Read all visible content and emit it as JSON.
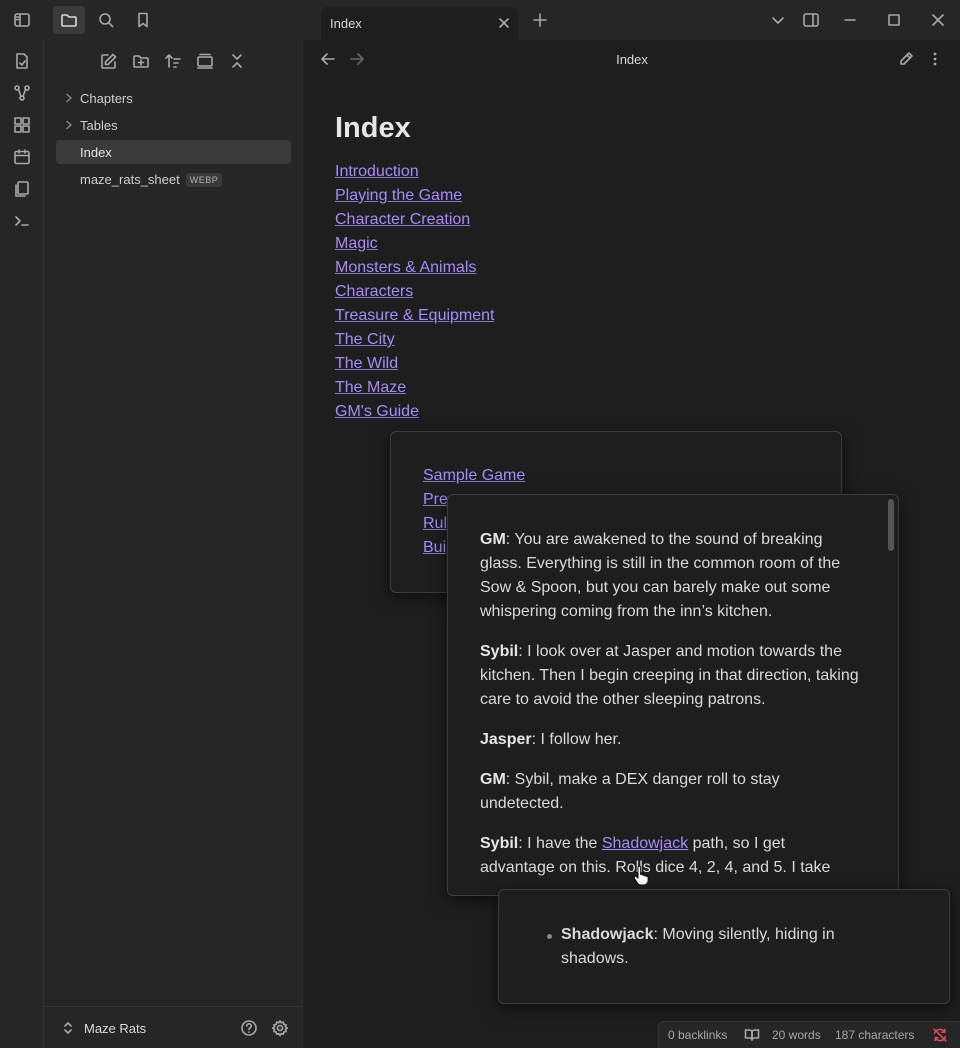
{
  "tab": {
    "title": "Index"
  },
  "view": {
    "title": "Index"
  },
  "sidebar": {
    "items": [
      {
        "label": "Chapters",
        "type": "folder"
      },
      {
        "label": "Tables",
        "type": "folder"
      },
      {
        "label": "Index",
        "type": "file",
        "selected": true
      },
      {
        "label": "maze_rats_sheet",
        "type": "file",
        "badge": "WEBP"
      }
    ],
    "vault_name": "Maze Rats"
  },
  "note": {
    "heading": "Index",
    "links": [
      "Introduction",
      "Playing the Game",
      "Character Creation",
      "Magic",
      "Monsters & Animals",
      "Characters",
      "Treasure & Equipment",
      "The City",
      "The Wild",
      "The Maze",
      "GM's Guide"
    ]
  },
  "popover1": {
    "links": [
      "Sample Game",
      "Pre",
      "Rul",
      "Bui"
    ]
  },
  "popover2": {
    "p1_speaker": "GM",
    "p1_text": ": You are awakened to the sound of breaking glass. Everything is still in the common room of the Sow & Spoon, but you can barely make out some whispering coming from the inn’s kitchen.",
    "p2_speaker": "Sybil",
    "p2_text": ": I look over at Jasper and motion towards the kitchen. Then I begin creeping in that direction, taking care to avoid the other sleeping patrons.",
    "p3_speaker": "Jasper",
    "p3_text": ": I follow her.",
    "p4_speaker": "GM",
    "p4_text": ": Sybil, make a DEX danger roll to stay undetected.",
    "p5_speaker": "Sybil",
    "p5_pre": ": I have the ",
    "p5_link": "Shadowjack",
    "p5_post": " path, so I get advantage on this. Rolls dice 4, 2, 4, and 5. I take"
  },
  "popover3": {
    "term": "Shadowjack",
    "desc": ": Moving silently, hiding in shadows."
  },
  "status": {
    "backlinks": "0 backlinks",
    "words": "20 words",
    "characters": "187 characters"
  },
  "colors": {
    "accent": "#a78bfa",
    "sync_error": "#e04f5f"
  }
}
